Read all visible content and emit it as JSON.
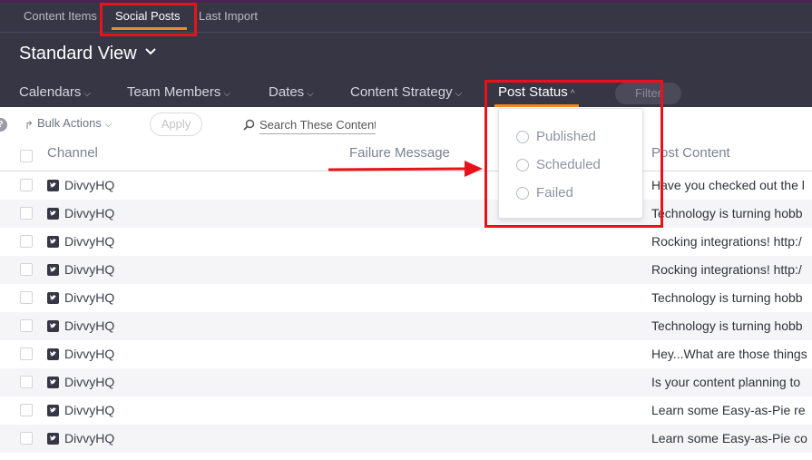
{
  "tabs": [
    {
      "label": "Content Items",
      "active": false
    },
    {
      "label": "Social Posts",
      "active": true
    },
    {
      "label": "Last Import",
      "active": false
    }
  ],
  "view": {
    "title": "Standard View"
  },
  "filters": [
    {
      "label": "Calendars"
    },
    {
      "label": "Team Members"
    },
    {
      "label": "Dates"
    },
    {
      "label": "Content Strategy"
    },
    {
      "label": "Post Status",
      "open": true
    }
  ],
  "filter_button": "Filter",
  "toolbar": {
    "bulk_actions": "Bulk Actions",
    "apply": "Apply",
    "search_placeholder": "Search These Content"
  },
  "columns": {
    "channel": "Channel",
    "failure_message": "Failure Message",
    "post_content": "Post Content"
  },
  "status_menu": {
    "options": [
      "Published",
      "Scheduled",
      "Failed"
    ]
  },
  "rows": [
    {
      "channel": "DivvyHQ",
      "content": "Have you checked out the l"
    },
    {
      "channel": "DivvyHQ",
      "content": "Technology is turning hobb"
    },
    {
      "channel": "DivvyHQ",
      "content": "Rocking integrations! http:/"
    },
    {
      "channel": "DivvyHQ",
      "content": "Rocking integrations! http:/"
    },
    {
      "channel": "DivvyHQ",
      "content": "Technology is turning hobb"
    },
    {
      "channel": "DivvyHQ",
      "content": "Technology is turning hobb"
    },
    {
      "channel": "DivvyHQ",
      "content": "Hey...What are those things"
    },
    {
      "channel": "DivvyHQ",
      "content": "Is your content planning to"
    },
    {
      "channel": "DivvyHQ",
      "content": "Learn some Easy-as-Pie re"
    },
    {
      "channel": "DivvyHQ",
      "content": "Learn some Easy-as-Pie co"
    }
  ],
  "colors": {
    "header_bg": "#363645",
    "accent": "#f08a24",
    "highlight": "#e8131a"
  }
}
